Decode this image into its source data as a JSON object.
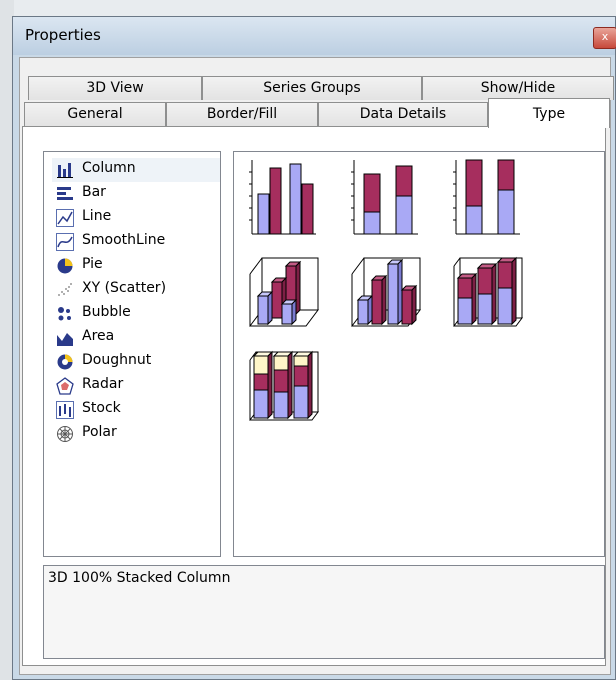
{
  "window": {
    "title": "Properties",
    "close_glyph": "x"
  },
  "tabs_row1": [
    {
      "label": "3D View"
    },
    {
      "label": "Series Groups"
    },
    {
      "label": "Show/Hide"
    }
  ],
  "tabs_row2": [
    {
      "label": "General"
    },
    {
      "label": "Border/Fill"
    },
    {
      "label": "Data Details"
    },
    {
      "label": "Type",
      "active": true
    }
  ],
  "chart_types": [
    {
      "label": "Column",
      "icon": "column-chart-icon",
      "selected": true
    },
    {
      "label": "Bar",
      "icon": "bar-chart-icon"
    },
    {
      "label": "Line",
      "icon": "line-chart-icon"
    },
    {
      "label": "SmoothLine",
      "icon": "smoothline-chart-icon"
    },
    {
      "label": "Pie",
      "icon": "pie-chart-icon"
    },
    {
      "label": "XY (Scatter)",
      "icon": "scatter-chart-icon"
    },
    {
      "label": "Bubble",
      "icon": "bubble-chart-icon"
    },
    {
      "label": "Area",
      "icon": "area-chart-icon"
    },
    {
      "label": "Doughnut",
      "icon": "doughnut-chart-icon"
    },
    {
      "label": "Radar",
      "icon": "radar-chart-icon"
    },
    {
      "label": "Stock",
      "icon": "stock-chart-icon"
    },
    {
      "label": "Polar",
      "icon": "polar-chart-icon"
    }
  ],
  "subtypes": [
    {
      "name": "clustered-column-thumbnail"
    },
    {
      "name": "stacked-column-thumbnail"
    },
    {
      "name": "100-stacked-column-thumbnail"
    },
    {
      "name": "3d-clustered-column-thumbnail"
    },
    {
      "name": "3d-column-thumbnail"
    },
    {
      "name": "3d-stacked-column-thumbnail"
    },
    {
      "name": "3d-100-stacked-column-thumbnail",
      "selected": true
    }
  ],
  "description": "3D 100% Stacked Column",
  "colors": {
    "series_blue": "#a9a9f5",
    "series_red": "#a62e5e",
    "series_cream": "#fff6c8",
    "window_frame": "#c9d9e7"
  }
}
